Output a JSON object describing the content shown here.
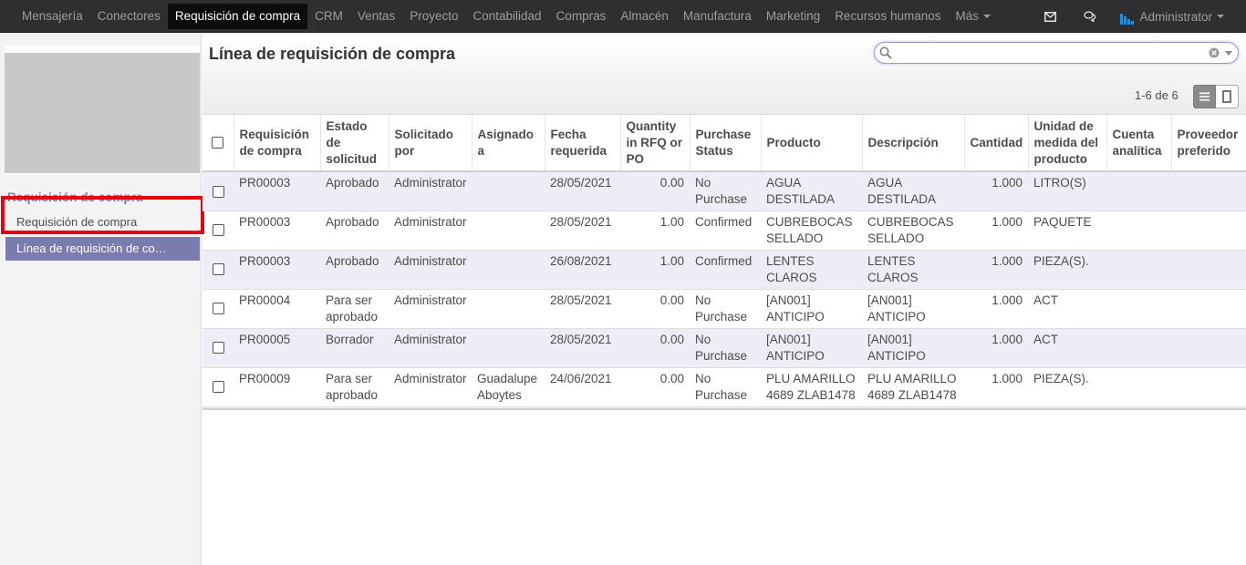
{
  "topbar": {
    "menu": [
      "Mensajería",
      "Conectores",
      "Requisición de compra",
      "CRM",
      "Ventas",
      "Proyecto",
      "Contabilidad",
      "Compras",
      "Almacén",
      "Manufactura",
      "Marketing",
      "Recursos humanos"
    ],
    "more_label": "Más",
    "active_menu": "Requisición de compra",
    "user_name": "Administrator"
  },
  "sidebar": {
    "heading": "Requisición de compra",
    "items": [
      {
        "label": "Requisición de compra",
        "active": false
      },
      {
        "label": "Línea de requisición de compra",
        "active": true
      }
    ]
  },
  "control_panel": {
    "title": "Línea de requisición de compra",
    "search_value": "",
    "pager": "1-6 de 6"
  },
  "table": {
    "columns": [
      "Requisición de compra",
      "Estado de solicitud",
      "Solicitado por",
      "Asignado a",
      "Fecha requerida",
      "Quantity in RFQ or PO",
      "Purchase Status",
      "Producto",
      "Descripción",
      "Cantidad",
      "Unidad de medida del producto",
      "Cuenta analítica",
      "Proveedor preferido"
    ],
    "rows": [
      [
        "PR00003",
        "Aprobado",
        "Administrator",
        "",
        "28/05/2021",
        "0.00",
        "No Purchase",
        "AGUA DESTILADA",
        "AGUA DESTILADA",
        "1.000",
        "LITRO(S)",
        "",
        ""
      ],
      [
        "PR00003",
        "Aprobado",
        "Administrator",
        "",
        "28/05/2021",
        "1.00",
        "Confirmed",
        "CUBREBOCAS SELLADO",
        "CUBREBOCAS SELLADO",
        "1.000",
        "PAQUETE",
        "",
        ""
      ],
      [
        "PR00003",
        "Aprobado",
        "Administrator",
        "",
        "26/08/2021",
        "1.00",
        "Confirmed",
        "LENTES CLAROS",
        "LENTES CLAROS",
        "1.000",
        "PIEZA(S).",
        "",
        ""
      ],
      [
        "PR00004",
        "Para ser aprobado",
        "Administrator",
        "",
        "28/05/2021",
        "0.00",
        "No Purchase",
        "[AN001] ANTICIPO",
        "[AN001] ANTICIPO",
        "1.000",
        "ACT",
        "",
        ""
      ],
      [
        "PR00005",
        "Borrador",
        "Administrator",
        "",
        "28/05/2021",
        "0.00",
        "No Purchase",
        "[AN001] ANTICIPO",
        "[AN001] ANTICIPO",
        "1.000",
        "ACT",
        "",
        ""
      ],
      [
        "PR00009",
        "Para ser aprobado",
        "Administrator",
        "Guadalupe Aboytes",
        "24/06/2021",
        "0.00",
        "No Purchase",
        "PLU AMARILLO 4689 ZLAB1478",
        "PLU AMARILLO 4689 ZLAB1478",
        "1.000",
        "PIEZA(S).",
        "",
        ""
      ]
    ]
  },
  "colors": {
    "accent": "#7c7bad",
    "topbar": "#2f2f2f",
    "highlight": "#e4000f"
  }
}
